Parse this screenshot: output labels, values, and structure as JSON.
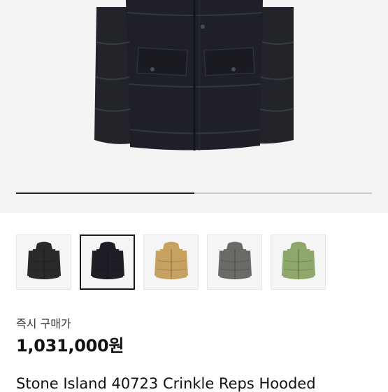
{
  "gallery": {
    "progress": 0.5,
    "thumbnails": [
      {
        "color_name": "black",
        "color": "#2a2a2a",
        "selected": false
      },
      {
        "color_name": "navy-black",
        "color": "#1e1f26",
        "selected": true
      },
      {
        "color_name": "tan",
        "color": "#c6a160",
        "selected": false
      },
      {
        "color_name": "grey",
        "color": "#6c6a66",
        "selected": false
      },
      {
        "color_name": "olive-green",
        "color": "#8ea76a",
        "selected": false
      }
    ]
  },
  "product": {
    "price_label": "즉시 구매가",
    "price": "1,031,000원",
    "title": "Stone Island 40723 Crinkle Reps Hooded"
  }
}
